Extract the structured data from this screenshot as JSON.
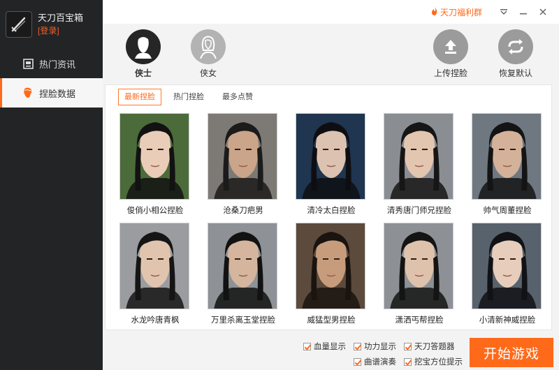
{
  "sidebar": {
    "app_name": "天刀百宝箱",
    "login_label": "[登录]",
    "items": [
      {
        "label": "热门资讯"
      },
      {
        "label": "捏脸数据"
      }
    ]
  },
  "topbar": {
    "promo": "天刀福利群"
  },
  "header": {
    "male_label": "侠士",
    "female_label": "侠女",
    "upload_label": "上传捏脸",
    "restore_label": "恢复默认"
  },
  "tabs": [
    {
      "label": "最新捏脸"
    },
    {
      "label": "热门捏脸"
    },
    {
      "label": "最多点赞"
    }
  ],
  "faces": [
    {
      "caption": "俊俏小相公捏脸",
      "bg": "#4c6b3a",
      "skin": "#e9cdb9",
      "hair": "#121212"
    },
    {
      "caption": "沧桑刀疤男",
      "bg": "#7d7a76",
      "skin": "#caa58a",
      "hair": "#1b1b1b"
    },
    {
      "caption": "清冷太白捏脸",
      "bg": "#1f3550",
      "skin": "#dcc2b0",
      "hair": "#0e0e12"
    },
    {
      "caption": "清秀唐门师兄捏脸",
      "bg": "#8a8e93",
      "skin": "#e3c6b0",
      "hair": "#161616"
    },
    {
      "caption": "帅气周董捏脸",
      "bg": "#6f7880",
      "skin": "#d4b29a",
      "hair": "#141414"
    },
    {
      "caption": "水龙吟唐青枫",
      "bg": "#9a9c9f",
      "skin": "#e1c4ad",
      "hair": "#151515"
    },
    {
      "caption": "万里杀离玉堂捏脸",
      "bg": "#8e9296",
      "skin": "#d5b59d",
      "hair": "#121212"
    },
    {
      "caption": "威猛型男捏脸",
      "bg": "#5c4a3c",
      "skin": "#c79c7c",
      "hair": "#1a1410"
    },
    {
      "caption": "潇洒丐帮捏脸",
      "bg": "#8d9196",
      "skin": "#dfc2ab",
      "hair": "#141414"
    },
    {
      "caption": "小清新神威捏脸",
      "bg": "#58626d",
      "skin": "#e7cdbb",
      "hair": "#101216"
    }
  ],
  "options": [
    {
      "label": "血量显示"
    },
    {
      "label": "功力显示"
    },
    {
      "label": "天刀答题器"
    },
    {
      "label": "曲谱演奏"
    },
    {
      "label": "挖宝方位提示"
    }
  ],
  "start_label": "开始游戏",
  "colors": {
    "accent": "#ff6a1a",
    "sidebar": "#222426"
  }
}
